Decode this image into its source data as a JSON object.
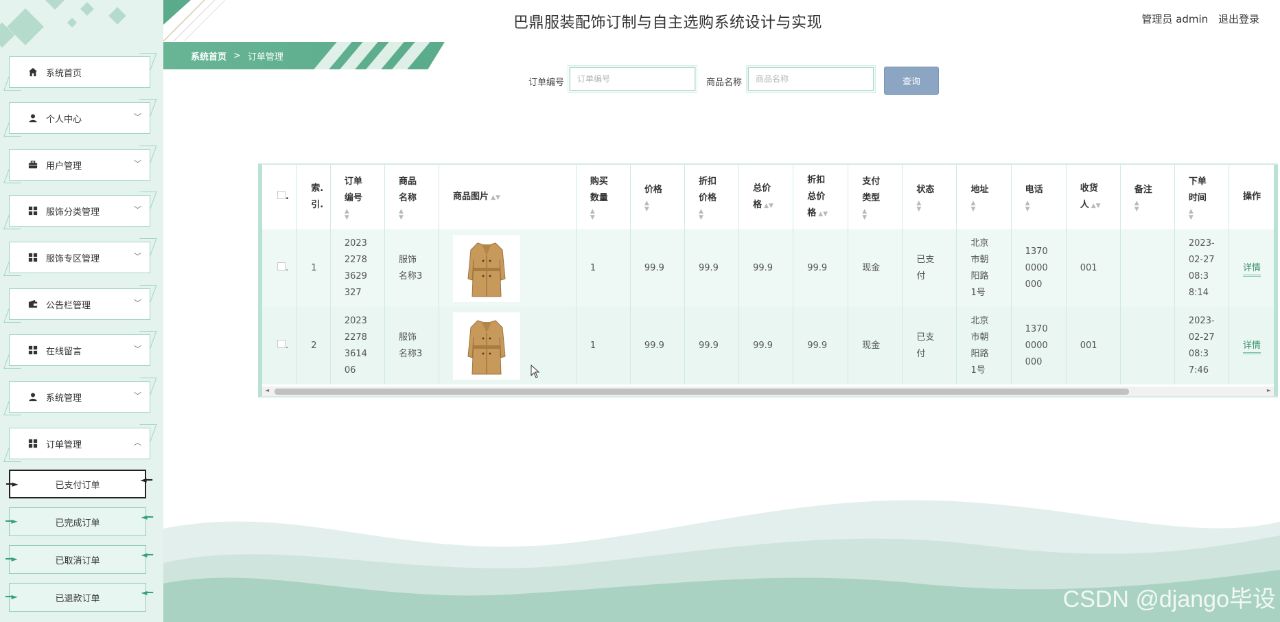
{
  "app": {
    "title": "巴鼎服装配饰订制与自主选购系统设计与实现",
    "user_label": "管理员 admin",
    "logout_label": "退出登录"
  },
  "breadcrumb": {
    "home": "系统首页",
    "separator": ">",
    "current": "订单管理"
  },
  "sidebar": {
    "items": [
      {
        "label": "系统首页",
        "icon": "home-icon",
        "expandable": false
      },
      {
        "label": "个人中心",
        "icon": "user-icon",
        "expandable": true
      },
      {
        "label": "用户管理",
        "icon": "briefcase-icon",
        "expandable": true
      },
      {
        "label": "服饰分类管理",
        "icon": "grid-icon",
        "expandable": true
      },
      {
        "label": "服饰专区管理",
        "icon": "grid-icon",
        "expandable": true
      },
      {
        "label": "公告栏管理",
        "icon": "wallet-icon",
        "expandable": true
      },
      {
        "label": "在线留言",
        "icon": "grid-icon",
        "expandable": true
      },
      {
        "label": "系统管理",
        "icon": "user-icon",
        "expandable": true
      },
      {
        "label": "订单管理",
        "icon": "grid-icon",
        "expandable": true,
        "expanded": true
      }
    ],
    "sub_items": [
      {
        "label": "已支付订单",
        "active": true
      },
      {
        "label": "已完成订单",
        "active": false
      },
      {
        "label": "已取消订单",
        "active": false
      },
      {
        "label": "已退款订单",
        "active": false
      }
    ]
  },
  "search": {
    "order_no_label": "订单编号",
    "order_no_placeholder": "订单编号",
    "product_name_label": "商品名称",
    "product_name_placeholder": "商品名称",
    "query_button": "查询"
  },
  "table": {
    "headers": {
      "index": [
        "索.",
        "引."
      ],
      "order_no": [
        "订单",
        "编号"
      ],
      "product_name": [
        "商品",
        "名称"
      ],
      "product_image": [
        "商品图片"
      ],
      "quantity": [
        "购买",
        "数量"
      ],
      "price": [
        "价格"
      ],
      "discount_price": [
        "折扣",
        "价格"
      ],
      "total_price": [
        "总价",
        "格"
      ],
      "discount_total": [
        "折扣",
        "总价",
        "格"
      ],
      "pay_type": [
        "支付",
        "类型"
      ],
      "status": [
        "状态"
      ],
      "address": [
        "地址"
      ],
      "phone": [
        "电话"
      ],
      "receiver": [
        "收货",
        "人"
      ],
      "remark": [
        "备注"
      ],
      "order_time": [
        "下单",
        "时间"
      ],
      "action": [
        "操作"
      ]
    },
    "rows": [
      {
        "index": "1",
        "order_no": [
          "2023",
          "2278",
          "3629",
          "327"
        ],
        "product_name": [
          "服饰",
          "名称3"
        ],
        "quantity": "1",
        "price": "99.9",
        "discount_price": "99.9",
        "total_price": "99.9",
        "discount_total": "99.9",
        "pay_type": "现金",
        "status": [
          "已支",
          "付"
        ],
        "address": [
          "北京",
          "市朝",
          "阳路",
          "1号"
        ],
        "phone": [
          "1370",
          "0000",
          "000"
        ],
        "receiver": "001",
        "remark": "",
        "order_time": [
          "2023-",
          "02-27",
          "08:3",
          "8:14"
        ],
        "action": "详情"
      },
      {
        "index": "2",
        "order_no": [
          "2023",
          "2278",
          "3614",
          "06"
        ],
        "product_name": [
          "服饰",
          "名称3"
        ],
        "quantity": "1",
        "price": "99.9",
        "discount_price": "99.9",
        "total_price": "99.9",
        "discount_total": "99.9",
        "pay_type": "现金",
        "status": [
          "已支",
          "付"
        ],
        "address": [
          "北京",
          "市朝",
          "阳路",
          "1号"
        ],
        "phone": [
          "1370",
          "0000",
          "000"
        ],
        "receiver": "001",
        "remark": "",
        "order_time": [
          "2023-",
          "02-27",
          "08:3",
          "7:46"
        ],
        "action": "详情"
      }
    ]
  },
  "watermark": "CSDN @django毕设",
  "colors": {
    "sidebar_bg": "#e4f3ee",
    "accent_green": "#5aab8b",
    "query_button": "#8ca5c2",
    "table_row": "#eef8f4"
  }
}
